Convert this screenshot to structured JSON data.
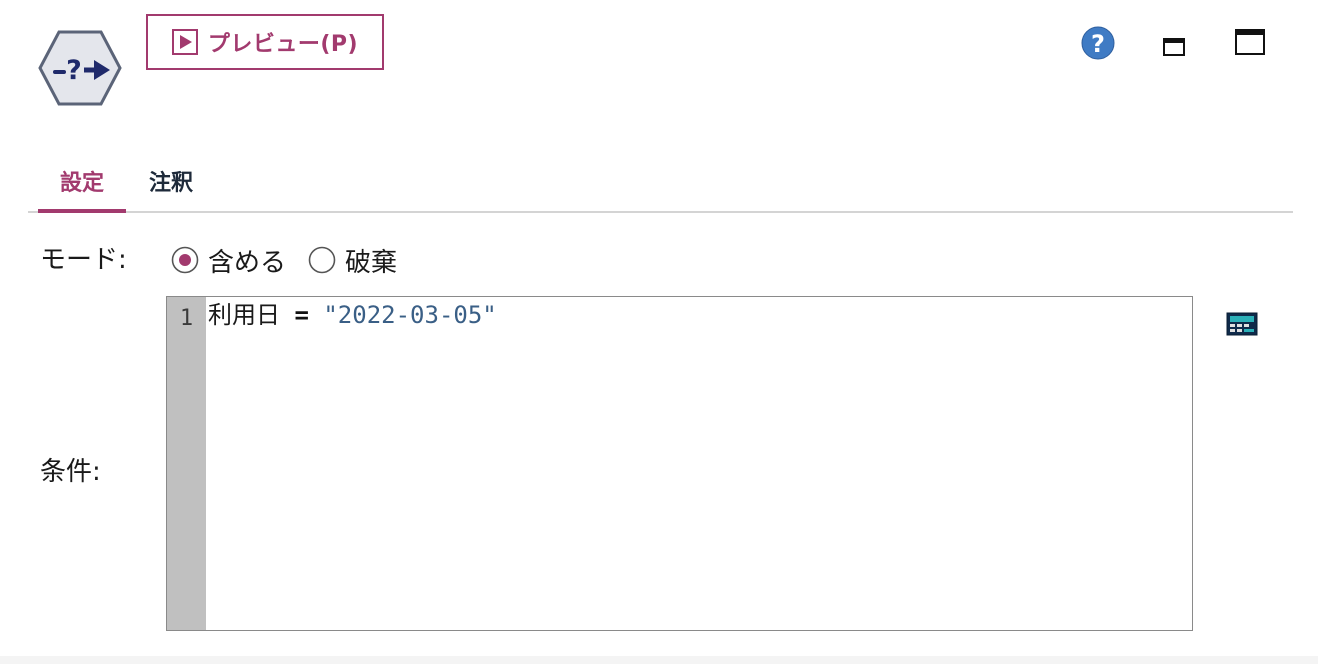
{
  "toolbar": {
    "preview_label": "プレビュー(P)"
  },
  "window_controls": {
    "help": "help-icon",
    "minimize": "minimize-icon",
    "maximize": "maximize-icon"
  },
  "tabs": [
    {
      "label": "設定",
      "selected": true
    },
    {
      "label": "注釈",
      "selected": false
    }
  ],
  "mode": {
    "label": "モード:",
    "options": [
      {
        "label": "含める",
        "selected": true
      },
      {
        "label": "破棄",
        "selected": false
      }
    ]
  },
  "condition": {
    "label": "条件:",
    "line_number": "1",
    "field": "利用日",
    "operator": "=",
    "value": "\"2022-03-05\""
  },
  "icons": {
    "node": "select-node-icon",
    "play": "play-icon",
    "expression_builder": "expression-builder-icon"
  },
  "colors": {
    "accent": "#a23a6e",
    "help_blue": "#3f7bc4",
    "string_blue": "#3a5f86",
    "gutter": "#c0c0c0",
    "node_fill": "#e4e6ec",
    "node_border": "#5b6478",
    "node_glyph": "#1f2a6b"
  }
}
